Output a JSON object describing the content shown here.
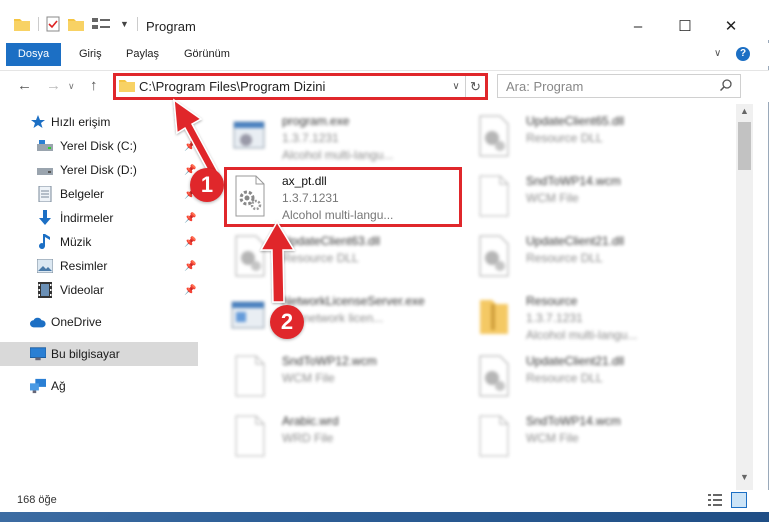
{
  "window": {
    "title": "Program",
    "controls": {
      "minimize": "–",
      "maximize": "☐",
      "close": "✕"
    }
  },
  "ribbon": {
    "tabs": [
      {
        "label": "Dosya",
        "active": true
      },
      {
        "label": "Giriş"
      },
      {
        "label": "Paylaş"
      },
      {
        "label": "Görünüm"
      }
    ],
    "help": "?"
  },
  "navigation": {
    "address": "C:\\Program Files\\Program Dizini",
    "search_placeholder": "Ara: Program"
  },
  "sidebar": {
    "items": [
      {
        "label": "Hızlı erişim",
        "icon": "star-icon"
      },
      {
        "label": "Yerel Disk (C:)",
        "icon": "drive-icon",
        "pinned": true
      },
      {
        "label": "Yerel Disk (D:)",
        "icon": "drive-icon",
        "pinned": true
      },
      {
        "label": "Belgeler",
        "icon": "documents-icon",
        "pinned": true
      },
      {
        "label": "İndirmeler",
        "icon": "download-icon",
        "pinned": true
      },
      {
        "label": "Müzik",
        "icon": "music-icon",
        "pinned": true
      },
      {
        "label": "Resimler",
        "icon": "pictures-icon",
        "pinned": true
      },
      {
        "label": "Videolar",
        "icon": "video-icon",
        "pinned": true
      },
      {
        "label": "OneDrive",
        "icon": "cloud-icon"
      },
      {
        "label": "Bu bilgisayar",
        "icon": "computer-icon",
        "selected": true
      },
      {
        "label": "Ağ",
        "icon": "network-icon"
      }
    ]
  },
  "files": {
    "highlighted": {
      "name": "ax_pt.dll",
      "version": "1.3.7.1231",
      "description": "Alcohol multi-langu..."
    },
    "others": [
      {
        "name": "program.exe",
        "line2": "1.3.7.1231",
        "line3": "Alcohol multi-langu..."
      },
      {
        "name": "UpdateClient65.dll",
        "line2": "Resource DLL",
        "line3": ""
      },
      {
        "name": "SndToWP14.wcm",
        "line2": "WCM File",
        "line3": ""
      },
      {
        "name": "UpdateClient63.dll",
        "line2": "Resource DLL",
        "line3": ""
      },
      {
        "name": "UpdateClient21.dll",
        "line2": "Resource DLL",
        "line3": ""
      },
      {
        "name": "NetworkLicenseServer.exe",
        "line2": "...Y network licen...",
        "line3": ""
      },
      {
        "name": "Resource",
        "line2": "1.3.7.1231",
        "line3": "Alcohol multi-langu..."
      },
      {
        "name": "SndToWP12.wcm",
        "line2": "WCM File",
        "line3": ""
      },
      {
        "name": "UpdateClient21.dll",
        "line2": "Resource DLL",
        "line3": ""
      },
      {
        "name": "Arabic.wrd",
        "line2": "WRD File",
        "line3": ""
      },
      {
        "name": "SndToWP14.wcm",
        "line2": "WCM File",
        "line3": ""
      }
    ]
  },
  "status": {
    "count": "168 öğe"
  },
  "callouts": {
    "one": "1",
    "two": "2"
  },
  "colors": {
    "accent": "#1c6fc4",
    "highlight": "#e0272b"
  }
}
